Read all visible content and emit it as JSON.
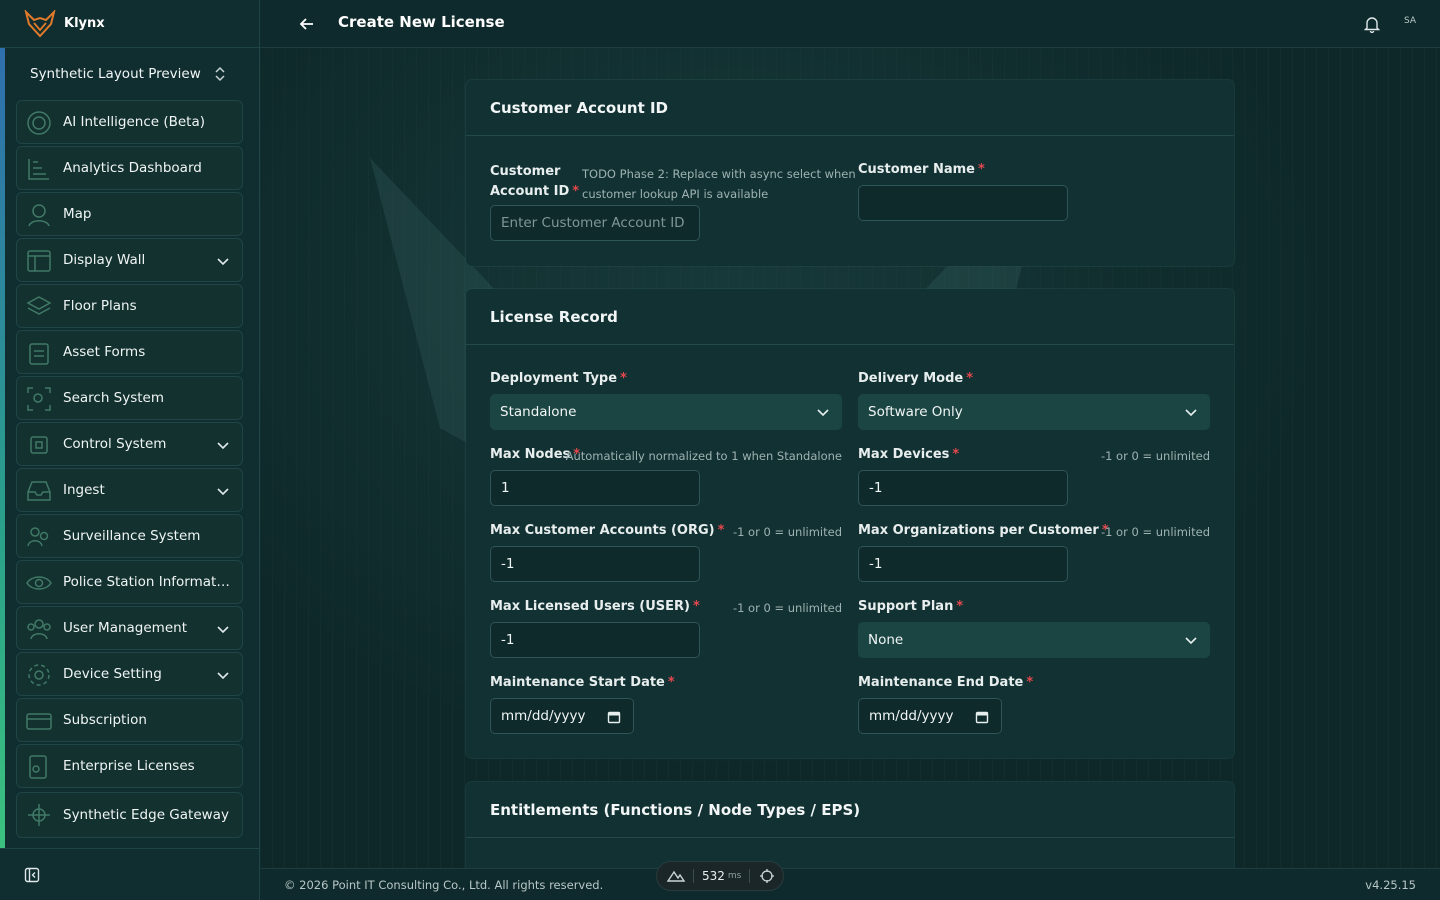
{
  "brand": {
    "name": "Klynx"
  },
  "project": {
    "name": "Synthetic Layout Preview"
  },
  "sidebar": {
    "items": [
      {
        "label": "AI Intelligence (Beta)",
        "icon": "radar-icon",
        "expandable": false
      },
      {
        "label": "Analytics Dashboard",
        "icon": "chart-icon",
        "expandable": false
      },
      {
        "label": "Map",
        "icon": "map-pin-icon",
        "expandable": false
      },
      {
        "label": "Display Wall",
        "icon": "monitor-icon",
        "expandable": true
      },
      {
        "label": "Floor Plans",
        "icon": "layers-icon",
        "expandable": false
      },
      {
        "label": "Asset Forms",
        "icon": "clipboard-icon",
        "expandable": false
      },
      {
        "label": "Search System",
        "icon": "scan-search-icon",
        "expandable": false
      },
      {
        "label": "Control System",
        "icon": "cpu-icon",
        "expandable": true
      },
      {
        "label": "Ingest",
        "icon": "inbox-icon",
        "expandable": true
      },
      {
        "label": "Surveillance System",
        "icon": "users-icon",
        "expandable": false
      },
      {
        "label": "Police Station Informati...",
        "icon": "eye-icon",
        "expandable": false
      },
      {
        "label": "User Management",
        "icon": "user-group-icon",
        "expandable": true
      },
      {
        "label": "Device Setting",
        "icon": "gear-icon",
        "expandable": true
      },
      {
        "label": "Subscription",
        "icon": "credit-card-icon",
        "expandable": false
      },
      {
        "label": "Enterprise Licenses",
        "icon": "license-icon",
        "expandable": false
      },
      {
        "label": "Synthetic Edge Gateway",
        "icon": "gateway-icon",
        "expandable": false
      }
    ]
  },
  "header": {
    "title": "Create New License",
    "avatar": "SA"
  },
  "customer_section": {
    "title": "Customer Account ID",
    "account_id": {
      "label_line1": "Customer",
      "label_line2": "Account ID",
      "hint_line1": "TODO Phase 2: Replace with async select when",
      "hint_line2": "customer lookup API is available",
      "placeholder": "Enter Customer Account ID",
      "value": ""
    },
    "customer_name": {
      "label": "Customer Name",
      "value": ""
    }
  },
  "license_section": {
    "title": "License Record",
    "deployment_type": {
      "label": "Deployment Type",
      "value": "Standalone"
    },
    "delivery_mode": {
      "label": "Delivery Mode",
      "value": "Software Only"
    },
    "max_nodes": {
      "label": "Max Nodes",
      "hint": "Automatically normalized to 1 when Standalone",
      "value": "1"
    },
    "max_devices": {
      "label": "Max Devices",
      "hint": "-1 or 0 = unlimited",
      "value": "-1"
    },
    "max_customer_accounts": {
      "label": "Max Customer Accounts (ORG)",
      "hint": "-1 or 0 = unlimited",
      "value": "-1"
    },
    "max_orgs_per_customer": {
      "label": "Max Organizations per Customer",
      "hint": "-1 or 0 = unlimited",
      "value": "-1"
    },
    "max_licensed_users": {
      "label": "Max Licensed Users (USER)",
      "hint": "-1 or 0 = unlimited",
      "value": "-1"
    },
    "support_plan": {
      "label": "Support Plan",
      "value": "None"
    },
    "maintenance_start": {
      "label": "Maintenance Start Date",
      "value": "mm/dd/yyyy"
    },
    "maintenance_end": {
      "label": "Maintenance End Date",
      "value": "mm/dd/yyyy"
    }
  },
  "entitlements_section": {
    "title": "Entitlements (Functions / Node Types / EPS)"
  },
  "required_mark": "*",
  "footer": {
    "copyright": "© 2026 Point IT Consulting Co., Ltd. All rights reserved.",
    "version": "v4.25.15",
    "perf_value": "532",
    "perf_unit": "ms"
  },
  "colors": {
    "accent": "#3cc17f",
    "required": "#e5484d",
    "background": "#0f2a2c",
    "card": "#123133"
  }
}
